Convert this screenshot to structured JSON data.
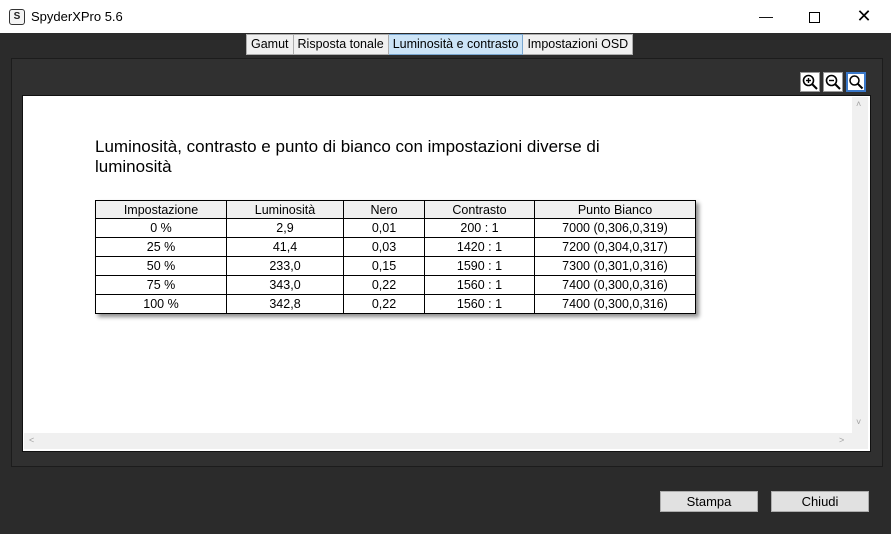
{
  "window": {
    "icon_letter": "S",
    "title": "SpyderXPro 5.6",
    "minimize_glyph": "—",
    "close_glyph": "✕"
  },
  "tabs": [
    {
      "label": "Gamut"
    },
    {
      "label": "Risposta tonale"
    },
    {
      "label": "Luminosità e contrasto",
      "active": true
    },
    {
      "label": "Impostazioni OSD"
    }
  ],
  "zoom_icons": [
    "zoom-in-icon",
    "zoom-out-icon",
    "zoom-fit-icon"
  ],
  "report": {
    "title": "Luminosità, contrasto e punto di bianco con impostazioni diverse di luminosità",
    "headers": [
      "Impostazione",
      "Luminosità",
      "Nero",
      "Contrasto",
      "Punto Bianco"
    ],
    "rows": [
      [
        "0 %",
        "2,9",
        "0,01",
        "200 : 1",
        "7000 (0,306,0,319)"
      ],
      [
        "25 %",
        "41,4",
        "0,03",
        "1420 : 1",
        "7200 (0,304,0,317)"
      ],
      [
        "50 %",
        "233,0",
        "0,15",
        "1590 : 1",
        "7300 (0,301,0,316)"
      ],
      [
        "75 %",
        "343,0",
        "0,22",
        "1560 : 1",
        "7400 (0,300,0,316)"
      ],
      [
        "100 %",
        "342,8",
        "0,22",
        "1560 : 1",
        "7400 (0,300,0,316)"
      ]
    ]
  },
  "buttons": {
    "print": "Stampa",
    "close": "Chiudi"
  },
  "colors": {
    "active_tab": "#cce4f7",
    "background": "#2b2b2b"
  }
}
